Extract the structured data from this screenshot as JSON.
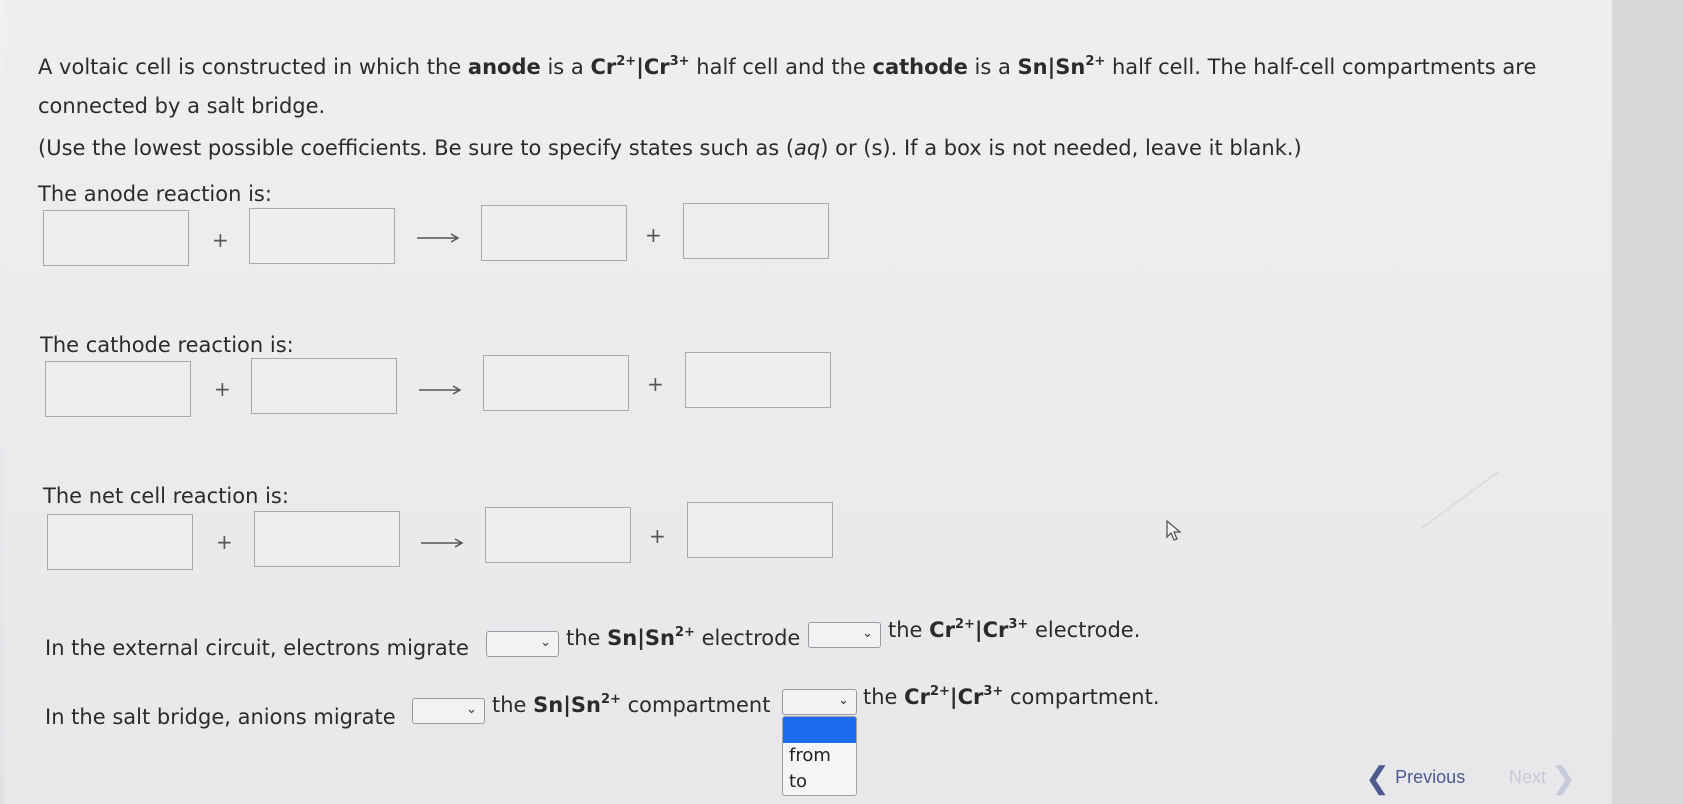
{
  "intro": {
    "p1": "A voltaic cell is constructed in which the",
    "anode_word": "anode",
    "p2": "is a",
    "anode_cell_a": "Cr",
    "anode_cell_a_charge": "2+",
    "bar": "|",
    "anode_cell_b": "Cr",
    "anode_cell_b_charge": "3+",
    "p3": "half cell and the",
    "cathode_word": "cathode",
    "p4": "is a",
    "cathode_cell_a": "Sn",
    "cathode_cell_b": "Sn",
    "cathode_cell_b_charge": "2+",
    "p5": "half cell. The half-cell compartments are",
    "line2": "connected by a salt bridge."
  },
  "instructions": {
    "t1": "(Use the lowest possible coefficients. Be sure to specify states such as (",
    "aq": "aq",
    "t2": ") or (",
    "s": "s",
    "t3": "). If a box is not needed, leave it blank.)"
  },
  "anode_reaction": {
    "label": "The anode reaction is:",
    "plus": "+",
    "boxes": [
      "",
      "",
      "",
      ""
    ]
  },
  "cathode_reaction": {
    "label": "The cathode reaction is:",
    "plus": "+",
    "boxes": [
      "",
      "",
      "",
      ""
    ]
  },
  "net_reaction": {
    "label": "The net cell reaction is:",
    "plus": "+",
    "boxes": [
      "",
      "",
      "",
      ""
    ]
  },
  "external_circuit": {
    "t1": "In the external circuit, electrons migrate",
    "t2": "the",
    "sn": "Sn",
    "bar": "|",
    "sn2": "Sn",
    "sn2_charge": "2+",
    "t3": "electrode",
    "t4": "the",
    "cr": "Cr",
    "cr_charge": "2+",
    "cr3": "Cr",
    "cr3_charge": "3+",
    "t5": "electrode.",
    "select1_value": "",
    "select2_value": ""
  },
  "salt_bridge": {
    "t1": "In the salt bridge, anions migrate",
    "t2": "the",
    "sn": "Sn",
    "bar": "|",
    "sn2": "Sn",
    "sn2_charge": "2+",
    "t3": "compartment",
    "t4": "the",
    "cr": "Cr",
    "cr_charge": "2+",
    "cr3": "Cr",
    "cr3_charge": "3+",
    "t5": "compartment.",
    "select1_value": "",
    "select2_value": ""
  },
  "dropdown_options": [
    "from",
    "to"
  ],
  "nav": {
    "previous": "Previous",
    "next": "Next"
  },
  "colors": {
    "highlight": "#1c6cf0",
    "previous": "#4c5a8e",
    "next_disabled": "#c8c9da"
  },
  "icons": [
    "chevron-down-icon",
    "chevron-left-icon",
    "chevron-right-icon",
    "mouse-cursor-icon",
    "arrow-right-icon"
  ]
}
